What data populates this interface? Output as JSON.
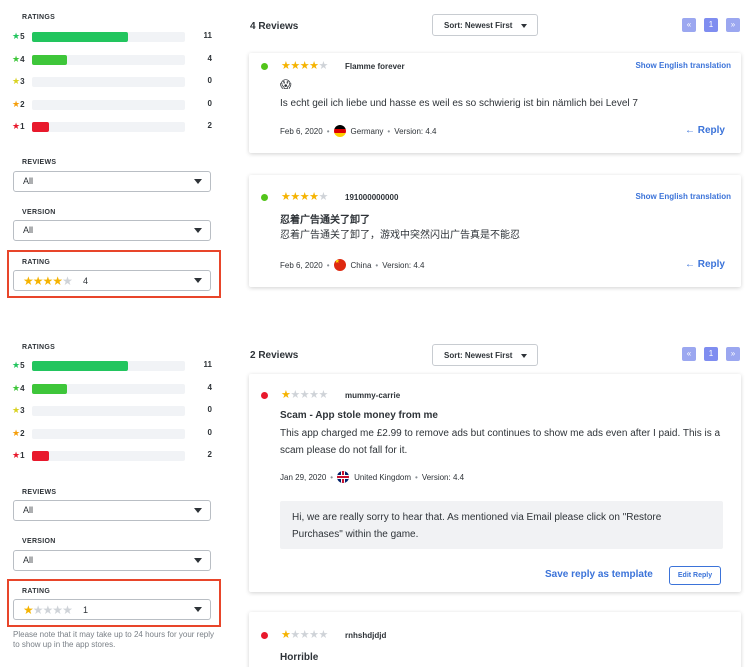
{
  "colors": {
    "accent": "#3b73d9",
    "bar_green": "#22c55e",
    "bar_red": "#e8192c",
    "star_gold": "#f5b301",
    "highlight": "#e8452a"
  },
  "panel1": {
    "sidebar": {
      "ratings_label": "RATINGS",
      "ratings": [
        {
          "star": "5",
          "count": "11",
          "fill": 0.63,
          "color": "#22c55e",
          "star_color": "#22c55e"
        },
        {
          "star": "4",
          "count": "4",
          "fill": 0.23,
          "color": "#3ec63a",
          "star_color": "#3ec63a"
        },
        {
          "star": "3",
          "count": "0",
          "fill": 0,
          "color": "#d9d223",
          "star_color": "#d9d223"
        },
        {
          "star": "2",
          "count": "0",
          "fill": 0,
          "color": "#f59e0b",
          "star_color": "#f59e0b"
        },
        {
          "star": "1",
          "count": "2",
          "fill": 0.11,
          "color": "#e8192c",
          "star_color": "#e8192c"
        }
      ],
      "reviews_label": "REVIEWS",
      "reviews_value": "All",
      "version_label": "VERSION",
      "version_value": "All",
      "rating_label": "RATING",
      "rating_value": "4",
      "rating_stars_filled": 4
    },
    "header": {
      "count_label": "4 Reviews",
      "sort_label": "Sort: Newest First",
      "pager": [
        "«",
        "1",
        "»"
      ]
    },
    "reviews": [
      {
        "stars": 4,
        "author": "Flamme forever",
        "translate": "Show English translation",
        "title": "😱",
        "body": "Is echt geil ich liebe und hasse es weil es so schwierig ist bin nämlich bei Level 7",
        "date": "Feb 6, 2020",
        "country": "Germany",
        "version": "Version: 4.4",
        "reply": "← Reply",
        "dot": "#52c41a"
      },
      {
        "stars": 4,
        "author": "191000000000",
        "translate": "Show English translation",
        "title": "忍着广告通关了卸了",
        "body": "忍着广告通关了卸了，游戏中突然闪出广告真是不能忍",
        "date": "Feb 6, 2020",
        "country": "China",
        "version": "Version: 4.4",
        "reply": "← Reply",
        "dot": "#52c41a"
      }
    ]
  },
  "panel2": {
    "sidebar": {
      "ratings_label": "RATINGS",
      "ratings": [
        {
          "star": "5",
          "count": "11",
          "fill": 0.63,
          "color": "#22c55e",
          "star_color": "#22c55e"
        },
        {
          "star": "4",
          "count": "4",
          "fill": 0.23,
          "color": "#3ec63a",
          "star_color": "#3ec63a"
        },
        {
          "star": "3",
          "count": "0",
          "fill": 0,
          "color": "#d9d223",
          "star_color": "#d9d223"
        },
        {
          "star": "2",
          "count": "0",
          "fill": 0,
          "color": "#f59e0b",
          "star_color": "#f59e0b"
        },
        {
          "star": "1",
          "count": "2",
          "fill": 0.11,
          "color": "#e8192c",
          "star_color": "#e8192c"
        }
      ],
      "reviews_label": "REVIEWS",
      "reviews_value": "All",
      "version_label": "VERSION",
      "version_value": "All",
      "rating_label": "RATING",
      "rating_value": "1",
      "rating_stars_filled": 1,
      "note": "Please note that it may take up to 24 hours for your reply to show up in the app stores."
    },
    "header": {
      "count_label": "2 Reviews",
      "sort_label": "Sort: Newest First",
      "pager": [
        "«",
        "1",
        "»"
      ]
    },
    "reviews": [
      {
        "stars": 1,
        "author": "mummy-carrie",
        "title": "Scam - App stole money from me",
        "body": "This app charged me £2.99 to remove ads but continues to show me ads even after I paid. This is a scam please do not fall for it.",
        "date": "Jan 29, 2020",
        "country": "United Kingdom",
        "version": "Version: 4.4",
        "dot": "#e8192c",
        "reply_text": "Hi, we are really sorry to hear that. As mentioned via Email please click on \"Restore Purchases\" within the game.",
        "save_template": "Save reply as template",
        "edit_reply": "Edit Reply"
      },
      {
        "stars": 1,
        "author": "rnhshdjdjd",
        "title": "Horrible",
        "dot": "#e8192c"
      }
    ]
  }
}
